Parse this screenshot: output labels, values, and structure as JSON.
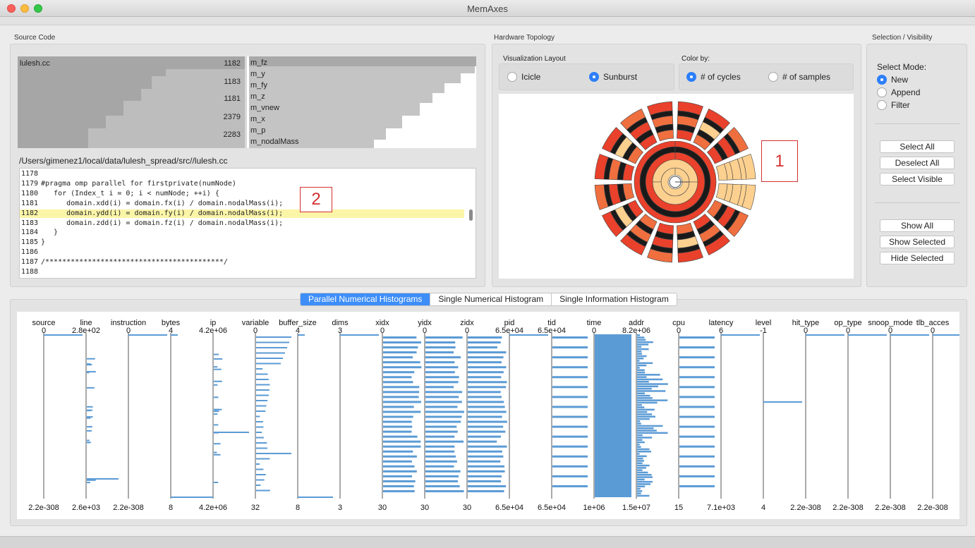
{
  "window": {
    "title": "MemAxes"
  },
  "sections": {
    "source_code": "Source Code",
    "hardware_topology": "Hardware Topology",
    "selection_visibility": "Selection / Visibility"
  },
  "source_tree": {
    "file": "lulesh.cc",
    "counts": [
      "1182",
      "1183",
      "1181",
      "2379",
      "2283"
    ],
    "variables": [
      "m_fz",
      "m_y",
      "m_fy",
      "m_z",
      "m_vnew",
      "m_x",
      "m_p",
      "m_nodalMass"
    ]
  },
  "file_path": "/Users/gimenez1/local/data/lulesh_spread/src//lulesh.cc",
  "code_lines": [
    {
      "n": "1178",
      "t": ""
    },
    {
      "n": "1179",
      "t": "#pragma omp parallel for firstprivate(numNode)"
    },
    {
      "n": "1180",
      "t": "   for (Index_t i = 0; i < numNode; ++i) {"
    },
    {
      "n": "1181",
      "t": "      domain.xdd(i) = domain.fx(i) / domain.nodalMass(i);"
    },
    {
      "n": "1182",
      "t": "      domain.ydd(i) = domain.fy(i) / domain.nodalMass(i);"
    },
    {
      "n": "1183",
      "t": "      domain.zdd(i) = domain.fz(i) / domain.nodalMass(i);"
    },
    {
      "n": "1184",
      "t": "   }"
    },
    {
      "n": "1185",
      "t": "}"
    },
    {
      "n": "1186",
      "t": ""
    },
    {
      "n": "1187",
      "t": "/******************************************/"
    },
    {
      "n": "1188",
      "t": ""
    }
  ],
  "highlighted_line": "1182",
  "markers": {
    "one": "1",
    "two": "2"
  },
  "layout_group": {
    "title": "Visualization Layout",
    "options": [
      "Icicle",
      "Sunburst"
    ],
    "selected": "Sunburst"
  },
  "color_group": {
    "title": "Color by:",
    "options": [
      "# of cycles",
      "# of samples"
    ],
    "selected": "# of cycles"
  },
  "select_mode": {
    "title": "Select Mode:",
    "options": [
      "New",
      "Append",
      "Filter"
    ],
    "selected": "New"
  },
  "buttons": {
    "select_all": "Select All",
    "deselect_all": "Deselect All",
    "select_visible": "Select Visible",
    "show_all": "Show All",
    "show_selected": "Show Selected",
    "hide_selected": "Hide Selected"
  },
  "tabs": [
    "Parallel Numerical Histograms",
    "Single Numerical Histogram",
    "Single Information Histogram"
  ],
  "active_tab": "Parallel Numerical Histograms",
  "colors": {
    "accent": "#3d8ef8",
    "bar": "#5b9bd5",
    "highlight": "#fbf5a8",
    "marker": "#d43030",
    "sun_dark": "#e9412b",
    "sun_mid": "#f06f3f",
    "sun_light": "#fcd08f"
  },
  "axes": [
    {
      "name": "source",
      "top": "0",
      "bottom": "2.2e-308"
    },
    {
      "name": "line",
      "top": "2.8e+02",
      "bottom": "2.6e+03"
    },
    {
      "name": "instruction",
      "top": "0",
      "bottom": "2.2e-308"
    },
    {
      "name": "bytes",
      "top": "4",
      "bottom": "8"
    },
    {
      "name": "ip",
      "top": "4.2e+06",
      "bottom": "4.2e+06"
    },
    {
      "name": "variable",
      "top": "0",
      "bottom": "32"
    },
    {
      "name": "buffer_size",
      "top": "4",
      "bottom": "8"
    },
    {
      "name": "dims",
      "top": "3",
      "bottom": "3"
    },
    {
      "name": "xidx",
      "top": "0",
      "bottom": "30"
    },
    {
      "name": "yidx",
      "top": "0",
      "bottom": "30"
    },
    {
      "name": "zidx",
      "top": "0",
      "bottom": "30"
    },
    {
      "name": "pid",
      "top": "6.5e+04",
      "bottom": "6.5e+04"
    },
    {
      "name": "tid",
      "top": "6.5e+04",
      "bottom": "6.5e+04"
    },
    {
      "name": "time",
      "top": "0",
      "bottom": "1e+06"
    },
    {
      "name": "addr",
      "top": "8.2e+06",
      "bottom": "1.5e+07"
    },
    {
      "name": "cpu",
      "top": "0",
      "bottom": "15"
    },
    {
      "name": "latency",
      "top": "6",
      "bottom": "7.1e+03"
    },
    {
      "name": "level",
      "top": "-1",
      "bottom": "4"
    },
    {
      "name": "hit_type",
      "top": "0",
      "bottom": "2.2e-308"
    },
    {
      "name": "op_type",
      "top": "0",
      "bottom": "2.2e-308"
    },
    {
      "name": "snoop_mode",
      "top": "0",
      "bottom": "2.2e-308"
    },
    {
      "name": "tlb_acces",
      "top": "0",
      "bottom": "2.2e-308"
    }
  ]
}
